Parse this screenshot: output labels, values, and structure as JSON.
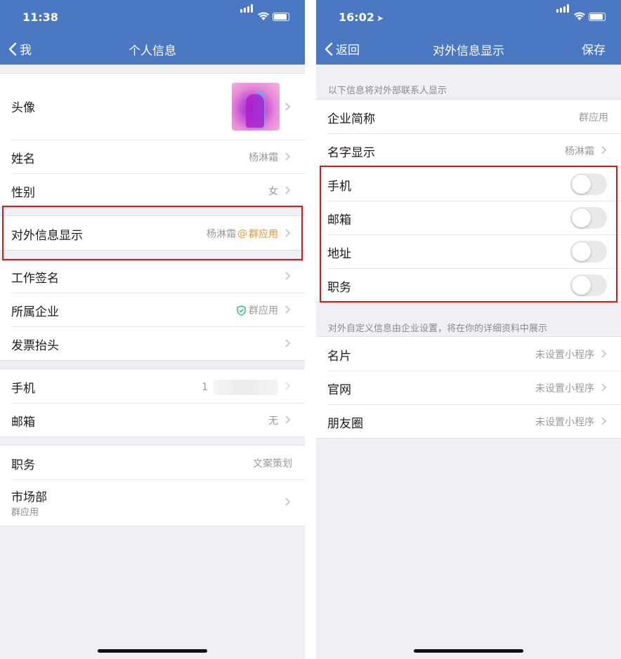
{
  "left": {
    "status_time": "11:38",
    "nav": {
      "back": "我",
      "title": "个人信息"
    },
    "avatar_label": "头像",
    "name": {
      "label": "姓名",
      "value": "杨淋霜"
    },
    "gender": {
      "label": "性别",
      "value": "女"
    },
    "external": {
      "label": "对外信息显示",
      "name": "杨淋霜",
      "at": "@",
      "company": "群应用"
    },
    "signature": {
      "label": "工作签名"
    },
    "enterprise": {
      "label": "所属企业",
      "value": "群应用"
    },
    "invoice": {
      "label": "发票抬头"
    },
    "phone": {
      "label": "手机",
      "value": "1"
    },
    "email": {
      "label": "邮箱",
      "value": "无"
    },
    "position": {
      "label": "职务",
      "value": "文案策划"
    },
    "department": {
      "label": "市场部",
      "sub": "群应用"
    }
  },
  "right": {
    "status_time": "16:02",
    "nav": {
      "back": "返回",
      "title": "对外信息显示",
      "save": "保存"
    },
    "hint_top": "以下信息将对外部联系人显示",
    "company_short": {
      "label": "企业简称",
      "value": "群应用"
    },
    "name_display": {
      "label": "名字显示",
      "value": "杨淋霜"
    },
    "toggles": [
      {
        "label": "手机",
        "on": false
      },
      {
        "label": "邮箱",
        "on": false
      },
      {
        "label": "地址",
        "on": false
      },
      {
        "label": "职务",
        "on": false
      }
    ],
    "hint_custom": "对外自定义信息由企业设置，将在你的详细资料中展示",
    "custom": [
      {
        "label": "名片",
        "value": "未设置小程序"
      },
      {
        "label": "官网",
        "value": "未设置小程序"
      },
      {
        "label": "朋友圈",
        "value": "未设置小程序"
      }
    ]
  },
  "colors": {
    "nav": "#4a78c2",
    "highlight": "#e01515",
    "orange": "#e8943a",
    "verified": "#2eb872"
  }
}
